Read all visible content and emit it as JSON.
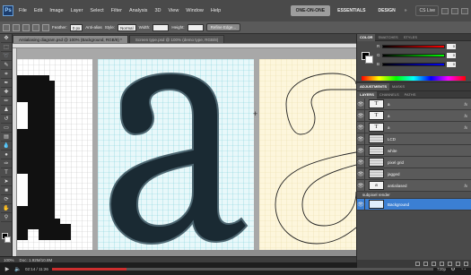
{
  "menubar": {
    "logo": "Ps",
    "items": [
      "File",
      "Edit",
      "Image",
      "Layer",
      "Select",
      "Filter",
      "Analysis",
      "3D",
      "View",
      "Window",
      "Help"
    ],
    "workspaces": [
      "ONE-ON-ONE",
      "ESSENTIALS",
      "DESIGN"
    ],
    "more": "»",
    "cs_live": "CS Live"
  },
  "options": {
    "feather_label": "Feather:",
    "feather_value": "0 px",
    "antialias_label": "Anti-alias",
    "style_label": "Style:",
    "style_value": "Normal",
    "width_label": "Width:",
    "height_label": "Height:",
    "refine_edge": "Refine Edge..."
  },
  "tabs": [
    {
      "label": "Antialiasing diagram.psd @ 100% (Background, RGB/8) *",
      "active": true
    },
    {
      "label": "Screen type.psd @ 100% (demo type, RGB/8)",
      "active": false
    }
  ],
  "status": {
    "zoom": "100%",
    "doc": "Doc: 1.92M/10.8M"
  },
  "player": {
    "time": "02:14 / 11:26",
    "progress": 0.196,
    "quality": "720p"
  },
  "color_panel": {
    "tabs": [
      "COLOR",
      "SWATCHES",
      "STYLES"
    ],
    "sliders": [
      {
        "label": "R",
        "value": "0"
      },
      {
        "label": "G",
        "value": "0"
      },
      {
        "label": "B",
        "value": "0"
      }
    ]
  },
  "adjust_panel": {
    "tabs": [
      "ADJUSTMENTS",
      "MASKS"
    ]
  },
  "layers_panel": {
    "tabs": [
      "LAYERS",
      "CHANNELS",
      "PATHS"
    ],
    "layers": [
      {
        "name": "a",
        "thumb": "T",
        "kind": "text",
        "fx": "fx"
      },
      {
        "name": "a",
        "thumb": "T",
        "kind": "text",
        "fx": "fx"
      },
      {
        "name": "a",
        "thumb": "T",
        "kind": "text",
        "fx": "fx"
      },
      {
        "name": "LCD",
        "thumb": "",
        "kind": "grid",
        "fx": ""
      },
      {
        "name": "white",
        "thumb": "",
        "kind": "grid",
        "fx": ""
      },
      {
        "name": "pixel grid",
        "thumb": "",
        "kind": "grid",
        "fx": ""
      },
      {
        "name": "jagged",
        "thumb": "",
        "kind": "grid",
        "fx": ""
      },
      {
        "name": "antialiased",
        "thumb": "a",
        "kind": "text",
        "fx": "fx"
      },
      {
        "name": "subpixel render",
        "thumb": "",
        "kind": "group",
        "fx": ""
      },
      {
        "name": "Background",
        "thumb": "",
        "kind": "blue",
        "fx": "",
        "selected": true
      }
    ]
  },
  "colors": {
    "selection": "#3b7fd3",
    "progress": "#cc2e2e",
    "grid_blue": "#7fd0d8",
    "grid_paper": "#fdf6dc"
  }
}
